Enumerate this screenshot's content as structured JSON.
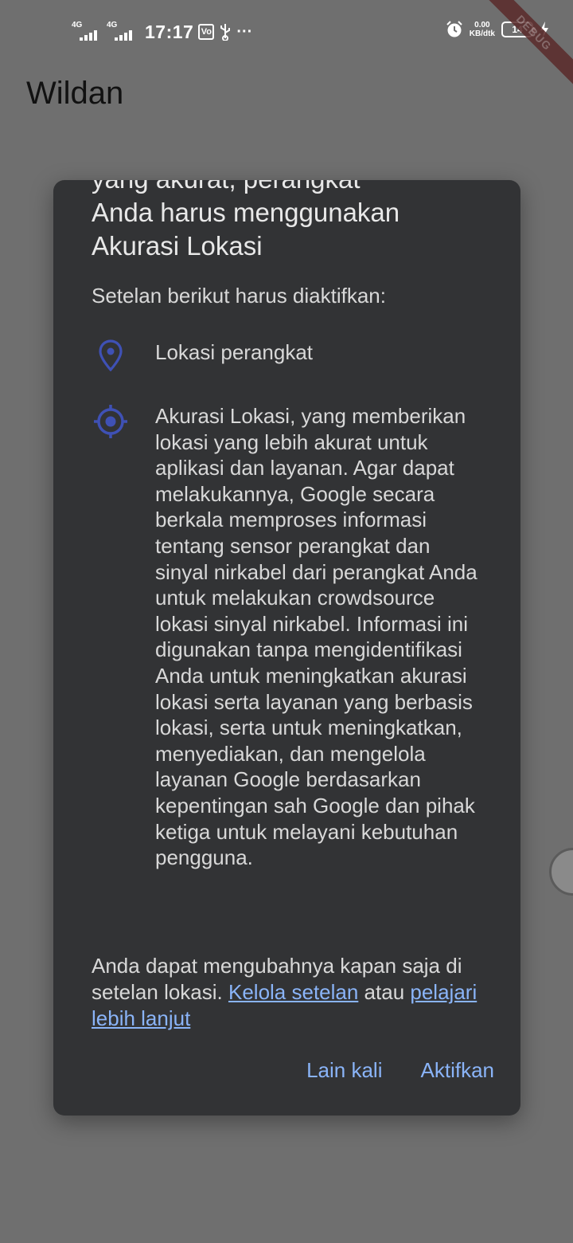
{
  "status_bar": {
    "network_1": "4G",
    "network_2": "4G",
    "time": "17:17",
    "more": "···",
    "speed_value": "0.00",
    "speed_unit": "KB/dtk",
    "battery": "14"
  },
  "debug_banner": "DEBUG",
  "app_bar": {
    "title": "Wildan"
  },
  "dialog": {
    "title_partial": "yang akurat, perangkat",
    "title_line_2": "Anda harus menggunakan",
    "title_line_3": "Akurasi Lokasi",
    "subtitle": "Setelan berikut harus diaktifkan:",
    "items": [
      {
        "icon": "location-pin-icon",
        "text": "Lokasi perangkat"
      },
      {
        "icon": "gps-target-icon",
        "text": "Akurasi Lokasi, yang memberikan lokasi yang lebih akurat untuk aplikasi dan layanan. Agar dapat melakukannya, Google secara berkala memproses informasi tentang sensor perangkat dan sinyal nirkabel dari perangkat Anda untuk melakukan crowdsource lokasi sinyal nirkabel. Informasi ini digunakan tanpa mengidentifikasi Anda untuk meningkatkan akurasi lokasi serta layanan yang berbasis lokasi, serta untuk meningkatkan, menyediakan, dan mengelola layanan Google berdasarkan kepentingan sah Google dan pihak ketiga untuk melayani kebutuhan pengguna."
      }
    ],
    "footer": {
      "text_1": "Anda dapat mengubahnya kapan saja di setelan lokasi. ",
      "link_manage": "Kelola setelan",
      "text_2": " atau ",
      "link_learn": "pelajari lebih lanjut"
    },
    "buttons": {
      "later": "Lain kali",
      "enable": "Aktifkan"
    }
  },
  "colors": {
    "dialog_bg": "#323335",
    "accent_link": "#8ab4f8",
    "icon_blue": "#3f51b5",
    "scrim": "#6f6f6f"
  }
}
